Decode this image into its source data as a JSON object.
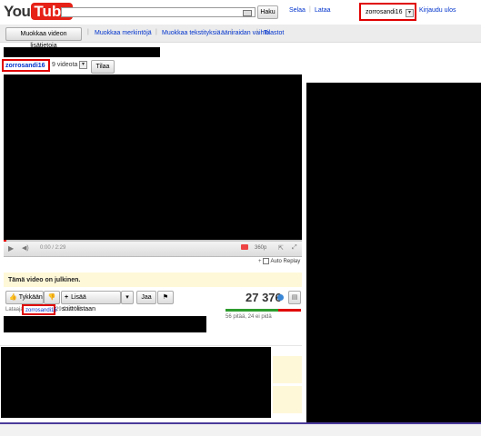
{
  "header": {
    "logo_you": "You",
    "logo_tube": "Tube",
    "search_button": "Haku",
    "nav_browse": "Selaa",
    "nav_upload": "Lataa",
    "username": "zorrosandi16",
    "logout": "Kirjaudu ulos"
  },
  "subnav": {
    "edit_info_button": "Muokkaa videon lisätietoja",
    "links": [
      "Muokkaa merkintöjä",
      "Muokkaa tekstityksiä",
      "ääniraidan vaihto",
      "Tilastot"
    ]
  },
  "channel": {
    "name": "zorrosandi16",
    "video_count": "9 videota",
    "subscribe": "Tilaa"
  },
  "player": {
    "time": "0:00 / 2:29",
    "quality": "360p",
    "auto_replay": "Auto Replay"
  },
  "notice": "Tämä video on julkinen.",
  "actions": {
    "like": "Tykkään",
    "add_playlist": "Lisää soittolistaan",
    "share": "Jaa",
    "views": "27 376",
    "ratings": "56 pitää, 24 ei pidä"
  },
  "uploader": {
    "label": "Lataaja",
    "name": "zorrosandi16",
    "date": "29.01.2011"
  }
}
